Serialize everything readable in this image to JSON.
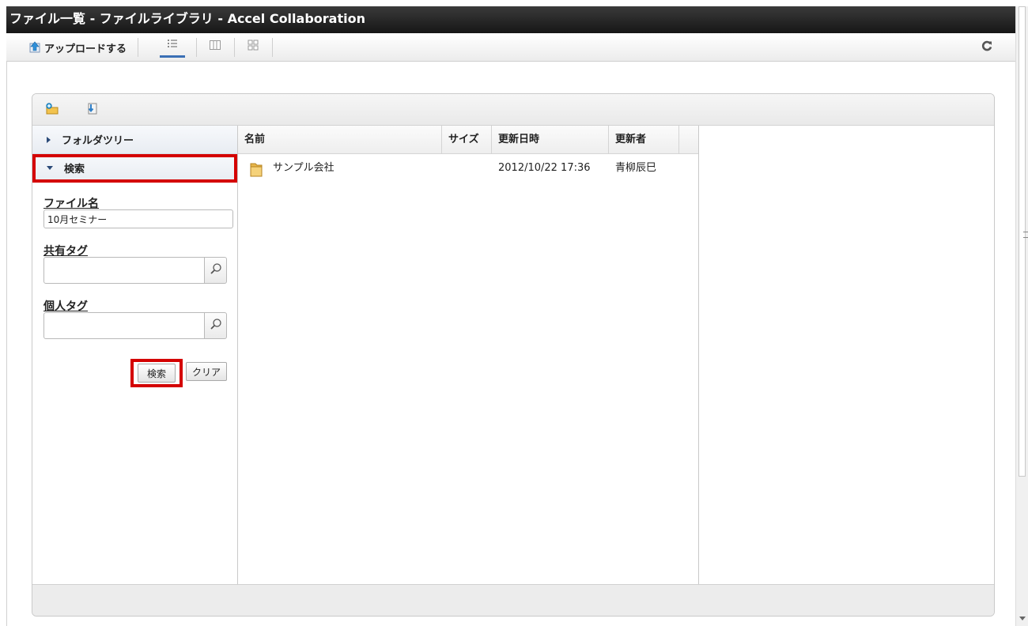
{
  "window": {
    "title": "ファイル一覧 - ファイルライブラリ - Accel Collaboration"
  },
  "toolbar": {
    "upload_label": "アップロードする",
    "view_buttons": [
      {
        "icon": "list-view-icon",
        "active": true
      },
      {
        "icon": "column-view-icon",
        "active": false
      },
      {
        "icon": "thumbnail-view-icon",
        "active": false
      }
    ],
    "refresh_icon": "refresh-icon"
  },
  "panel": {
    "header_icons": [
      "new-folder-icon",
      "download-icon"
    ],
    "sidebar": {
      "folder_tree_label": "フォルダツリー",
      "search_label": "検索"
    },
    "search_form": {
      "filename_label": "ファイル名",
      "filename_value": "10月セミナー",
      "shared_tag_label": "共有タグ",
      "shared_tag_value": "",
      "personal_tag_label": "個人タグ",
      "personal_tag_value": "",
      "search_button": "検索",
      "clear_button": "クリア"
    },
    "list": {
      "columns": [
        "名前",
        "サイズ",
        "更新日時",
        "更新者"
      ],
      "rows": [
        {
          "type": "folder",
          "name": "サンプル会社",
          "size": "",
          "updated": "2012/10/22 17:36",
          "updater": "青柳辰巳"
        }
      ]
    }
  },
  "colors": {
    "highlight": "#d40000",
    "titlebar": "#1e1e1e",
    "active_view": "#3a6fb5"
  }
}
